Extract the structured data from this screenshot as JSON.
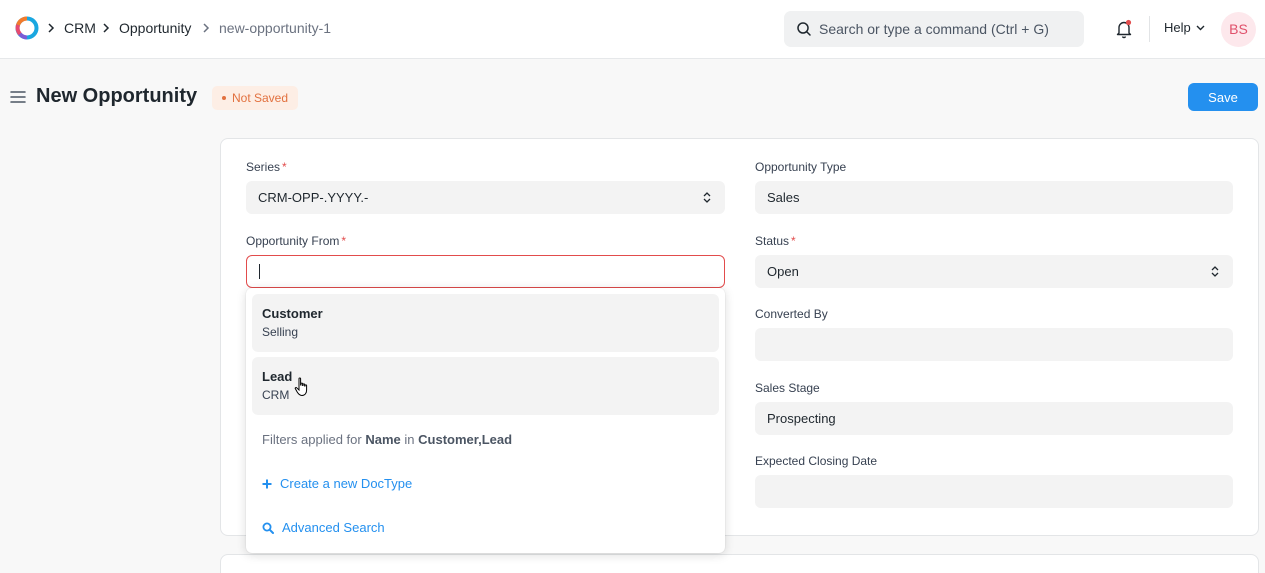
{
  "navbar": {
    "logo_icon": "app-logo-icon",
    "breadcrumbs": [
      "CRM",
      "Opportunity",
      "new-opportunity-1"
    ],
    "search_placeholder": "Search or type a command (Ctrl + G)",
    "help_label": "Help",
    "avatar_initials": "BS"
  },
  "page": {
    "title": "New Opportunity",
    "status": "Not Saved",
    "save_label": "Save"
  },
  "form": {
    "left": {
      "series": {
        "label": "Series",
        "value": "CRM-OPP-.YYYY.-"
      },
      "opportunity_from": {
        "label": "Opportunity From",
        "value": ""
      }
    },
    "right": {
      "opportunity_type": {
        "label": "Opportunity Type",
        "value": "Sales"
      },
      "status": {
        "label": "Status",
        "value": "Open"
      },
      "converted_by": {
        "label": "Converted By",
        "value": ""
      },
      "sales_stage": {
        "label": "Sales Stage",
        "value": "Prospecting"
      },
      "expected_closing_date": {
        "label": "Expected Closing Date",
        "value": ""
      }
    },
    "required_marker": "*"
  },
  "dropdown": {
    "items": [
      {
        "title": "Customer",
        "subtitle": "Selling"
      },
      {
        "title": "Lead",
        "subtitle": "CRM"
      }
    ],
    "filter": {
      "prefix": "Filters applied for",
      "field": "Name",
      "middle": "in",
      "doctypes": "Customer,Lead"
    },
    "create_label": "Create a new DocType",
    "advanced_label": "Advanced Search"
  },
  "colors": {
    "primary": "#2490ef",
    "danger": "#e24c4c",
    "warning": "#e2713f"
  }
}
